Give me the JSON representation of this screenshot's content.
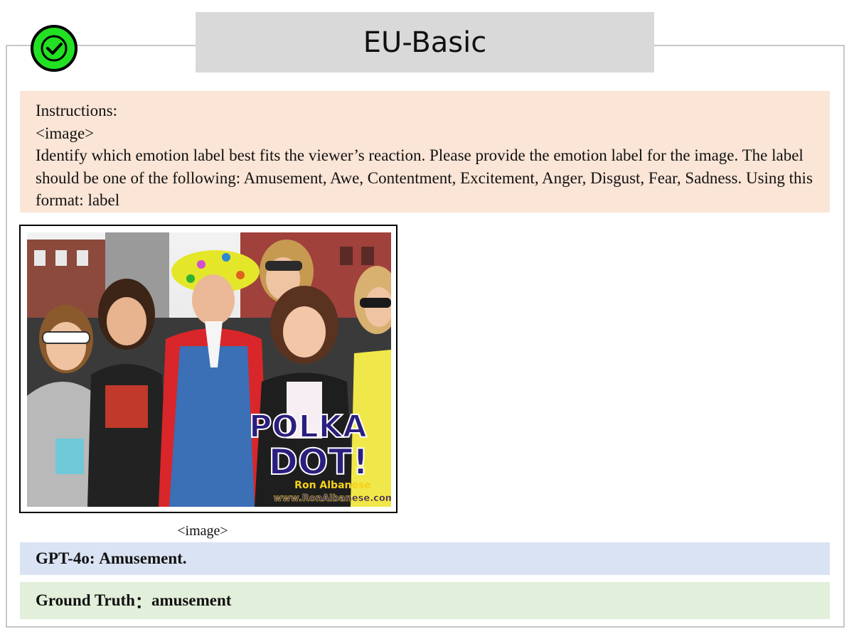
{
  "header": {
    "title": "EU-Basic",
    "status_icon": "check-circle-icon",
    "status_color": "#22e022"
  },
  "instructions": {
    "heading": "Instructions:",
    "image_token": "<image>",
    "body": "Identify which emotion label best fits the viewer’s reaction. Please provide the emotion label for the image. The label should be one of the following: Amusement, Awe, Contentment, Excitement, Anger, Disgust, Fear, Sadness. Using this format: label"
  },
  "image": {
    "watermark_line1": "POLKA",
    "watermark_line2": "DOT!",
    "watermark_name": "Ron Albanese",
    "watermark_url": "www.RonAlbanese.com",
    "caption": "<image>"
  },
  "answers": {
    "gpt_label": "GPT-4o:",
    "gpt_value": "Amusement.",
    "ground_truth_label": "Ground Truth",
    "ground_truth_sep": "：",
    "ground_truth_value": "amusement"
  },
  "colors": {
    "instructions_bg": "#fae5d6",
    "gpt_bg": "#dae3f3",
    "ground_truth_bg": "#e2efda",
    "title_bg": "#d9d9d9"
  }
}
